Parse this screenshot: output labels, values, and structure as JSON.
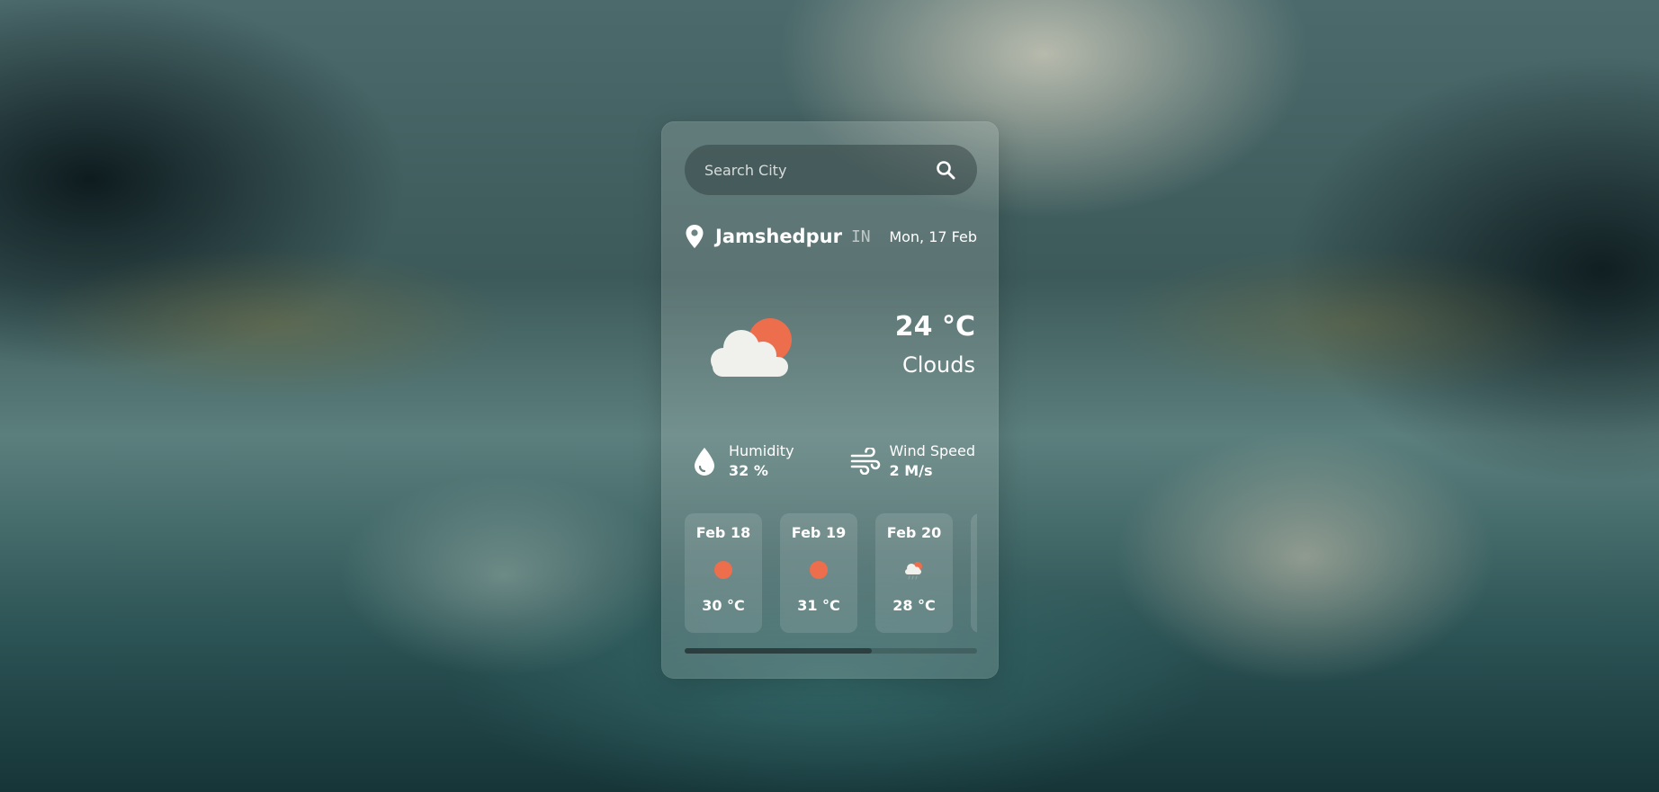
{
  "search": {
    "placeholder": "Search City",
    "value": ""
  },
  "location": {
    "city": "Jamshedpur",
    "country": "IN",
    "date": "Mon, 17 Feb"
  },
  "current": {
    "icon": "cloud-sun-icon",
    "temperature": "24 °C",
    "condition": "Clouds"
  },
  "stats": {
    "humidity_label": "Humidity",
    "humidity_value": "32 %",
    "wind_label": "Wind Speed",
    "wind_value": "2 M/s"
  },
  "forecast": [
    {
      "date": "Feb 18",
      "icon": "sun-icon",
      "temp": "30 °C"
    },
    {
      "date": "Feb 19",
      "icon": "sun-icon",
      "temp": "31 °C"
    },
    {
      "date": "Feb 20",
      "icon": "rain-cloud-icon",
      "temp": "28 °C"
    }
  ],
  "forecast_scroll_fraction": 0.64,
  "colors": {
    "accent": "#ec6e4c",
    "cloud": "#f0f0ec"
  }
}
